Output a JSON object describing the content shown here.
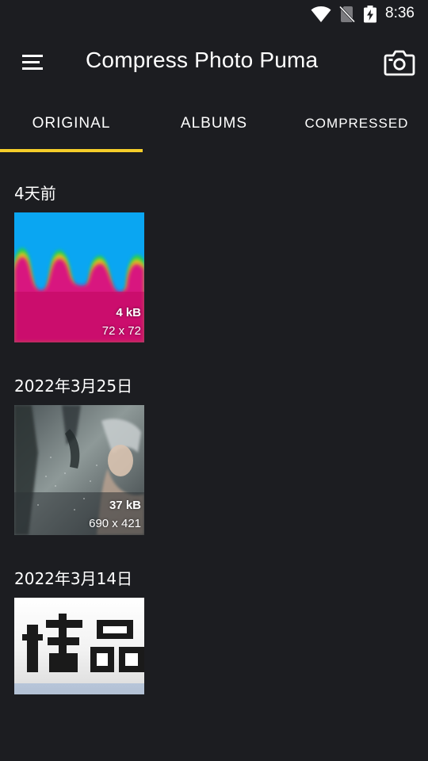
{
  "status_bar": {
    "time": "8:36",
    "icons": [
      "wifi-icon",
      "no-sim-icon",
      "battery-charging-icon"
    ]
  },
  "app_bar": {
    "title": "Compress Photo Puma",
    "left_icon": "menu-icon",
    "right_icon": "camera-icon"
  },
  "tabs": [
    {
      "label": "ORIGINAL",
      "selected": true
    },
    {
      "label": "ALBUMS",
      "selected": false
    },
    {
      "label": "COMPRESSED",
      "selected": false
    }
  ],
  "colors": {
    "background": "#1c1d21",
    "accent": "#f5cd2a",
    "text": "#ffffff"
  },
  "sections": [
    {
      "date": "4天前",
      "photos": [
        {
          "size": "4 kB",
          "dimensions": "72 x 72"
        }
      ]
    },
    {
      "date": "2022年3月25日",
      "photos": [
        {
          "size": "37 kB",
          "dimensions": "690 x 421"
        }
      ]
    },
    {
      "date": "2022年3月14日",
      "photos": [
        {
          "size": "",
          "dimensions": ""
        }
      ]
    }
  ]
}
